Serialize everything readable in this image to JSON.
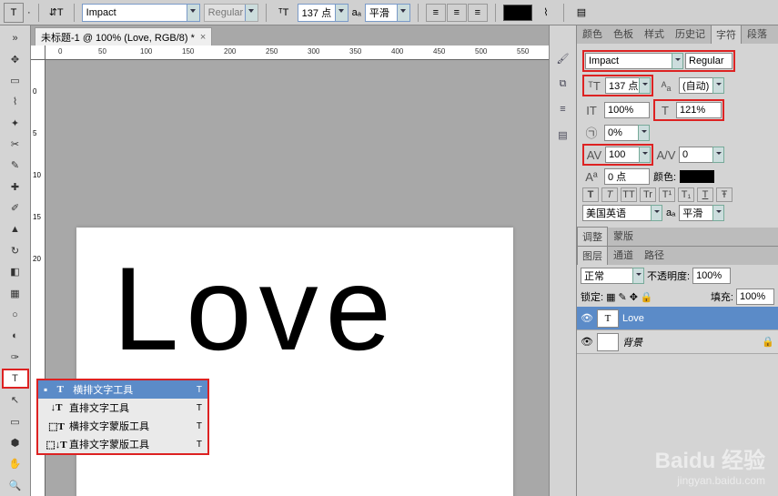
{
  "topbar": {
    "font": "Impact",
    "style": "Regular",
    "size": "137 点",
    "aa_label": "aₐ",
    "aa_mode": "平滑"
  },
  "doc": {
    "tab_title": "未标题-1 @ 100% (Love, RGB/8) *",
    "ruler_h": [
      "0",
      "50",
      "100",
      "150",
      "200",
      "250",
      "300",
      "350",
      "400",
      "450",
      "500",
      "550"
    ],
    "ruler_v": [
      "0",
      "5",
      "10",
      "15",
      "20"
    ],
    "canvas_text": "Love"
  },
  "flyout": {
    "items": [
      {
        "label": "横排文字工具",
        "key": "T"
      },
      {
        "label": "直排文字工具",
        "key": "T"
      },
      {
        "label": "横排文字蒙版工具",
        "key": "T"
      },
      {
        "label": "直排文字蒙版工具",
        "key": "T"
      }
    ]
  },
  "panel_tabs_top": [
    "颜色",
    "色板",
    "样式",
    "历史记",
    "字符",
    "段落"
  ],
  "char": {
    "font": "Impact",
    "style": "Regular",
    "size": "137 点",
    "leading_auto": "(自动)",
    "vscale": "100%",
    "hscale": "121%",
    "baseline": "0%",
    "tracking": "100",
    "kern": "0",
    "shift": "0 点",
    "color_label": "颜色:",
    "styles": [
      "T",
      "T",
      "TT",
      "Tr",
      "T¹",
      "T₁",
      "T",
      "Ŧ"
    ],
    "lang": "美国英语",
    "lang_aa_lbl": "aₐ",
    "lang_aa": "平滑"
  },
  "adjust_tabs": [
    "调整",
    "蒙版"
  ],
  "layer_tabs": [
    "图层",
    "通道",
    "路径"
  ],
  "layers": {
    "blend": "正常",
    "opacity_label": "不透明度:",
    "opacity": "100%",
    "lock_label": "锁定:",
    "fill_label": "填充:",
    "fill": "100%",
    "items": [
      {
        "name": "Love",
        "thumb": "T",
        "selected": true,
        "locked": false
      },
      {
        "name": "背景",
        "thumb": "",
        "selected": false,
        "locked": true
      }
    ]
  },
  "watermark": {
    "big": "Baidu 经验",
    "small": "jingyan.baidu.com"
  }
}
